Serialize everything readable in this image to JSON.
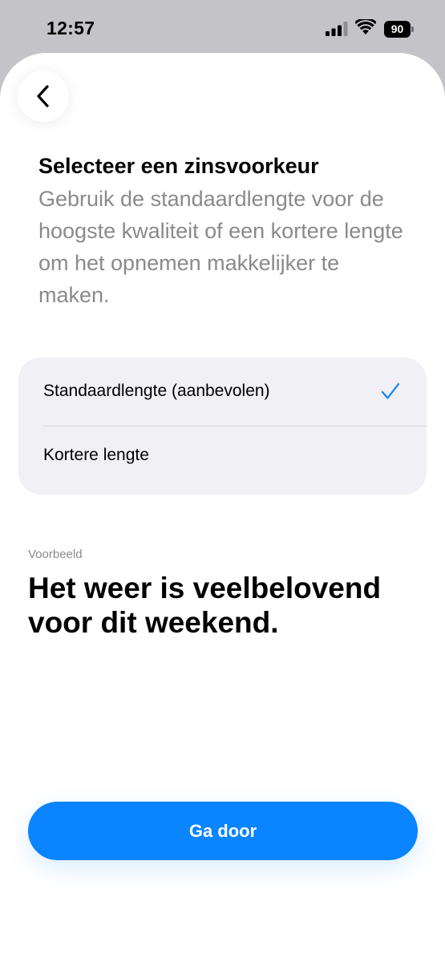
{
  "status_bar": {
    "time": "12:57",
    "battery_level": "90",
    "icons": [
      "signal-icon",
      "wifi-icon",
      "battery-icon"
    ]
  },
  "header": {
    "back_icon": "chevron-left-icon"
  },
  "content": {
    "title": "Selecteer een zinsvoorkeur",
    "description": "Gebruik de standaardlengte voor de hoogste kwaliteit of een kortere lengte om het opnemen makkelijker te maken."
  },
  "options": [
    {
      "label": "Standaardlengte (aanbevolen)",
      "selected": true
    },
    {
      "label": "Kortere lengte",
      "selected": false
    }
  ],
  "example": {
    "caption": "Voorbeeld",
    "sentence": "Het weer is veelbelovend voor dit weekend."
  },
  "footer": {
    "continue_label": "Ga door"
  },
  "colors": {
    "accent": "#0a84ff",
    "card_background": "#f0f0f5",
    "secondary_text": "#8a8a8e"
  }
}
